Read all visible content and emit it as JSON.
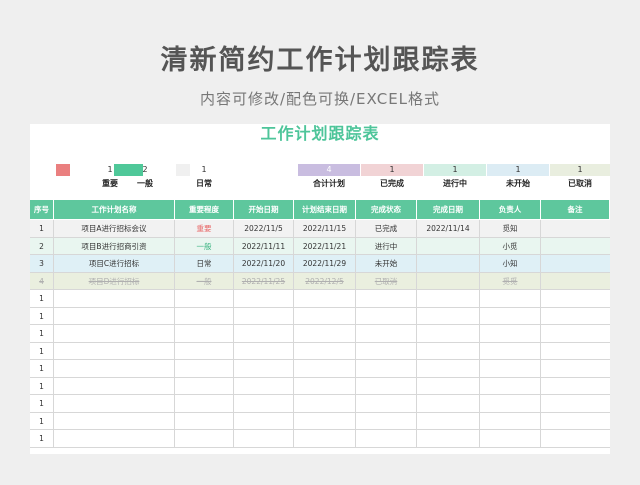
{
  "header": {
    "title": "清新简约工作计划跟踪表",
    "subtitle": "内容可修改/配色可换/EXCEL格式"
  },
  "sheet": {
    "title": "工作计划跟踪表"
  },
  "legend": [
    {
      "count": "1",
      "label": "重要",
      "color": "#ea7f7f"
    },
    {
      "count": "2",
      "label": "一般",
      "color": "#4fc899"
    },
    {
      "count": "1",
      "label": "日常",
      "color": "#f0f0f0"
    },
    {
      "count": "4",
      "label": "合计计划",
      "color": "#c9bde0"
    },
    {
      "count": "1",
      "label": "已完成",
      "color": "#f1d3d5"
    },
    {
      "count": "1",
      "label": "进行中",
      "color": "#d3efe4"
    },
    {
      "count": "1",
      "label": "未开始",
      "color": "#dcecf4"
    },
    {
      "count": "1",
      "label": "已取消",
      "color": "#e9eedf"
    }
  ],
  "table": {
    "columns": [
      "序号",
      "工作计划名称",
      "重要程度",
      "开始日期",
      "计划结束日期",
      "完成状态",
      "完成日期",
      "负责人",
      "备注"
    ],
    "rows": [
      {
        "no": "1",
        "name": "项目A进行招标会议",
        "priority": "重要",
        "start": "2022/11/5",
        "end": "2022/11/15",
        "status": "已完成",
        "done": "2022/11/14",
        "owner": "觅知",
        "note": ""
      },
      {
        "no": "2",
        "name": "项目B进行招商引资",
        "priority": "一般",
        "start": "2022/11/11",
        "end": "2022/11/21",
        "status": "进行中",
        "done": "",
        "owner": "小觅",
        "note": ""
      },
      {
        "no": "3",
        "name": "项目C进行招标",
        "priority": "日常",
        "start": "2022/11/20",
        "end": "2022/11/29",
        "status": "未开始",
        "done": "",
        "owner": "小知",
        "note": ""
      },
      {
        "no": "4",
        "name": "项目D进行招标",
        "priority": "一般",
        "start": "2022/11/25",
        "end": "2022/12/5",
        "status": "已取消",
        "done": "",
        "owner": "觅觅",
        "note": ""
      }
    ],
    "empty_row_numbers": [
      "1",
      "1",
      "1",
      "1",
      "1",
      "1",
      "1",
      "1",
      "1"
    ]
  }
}
